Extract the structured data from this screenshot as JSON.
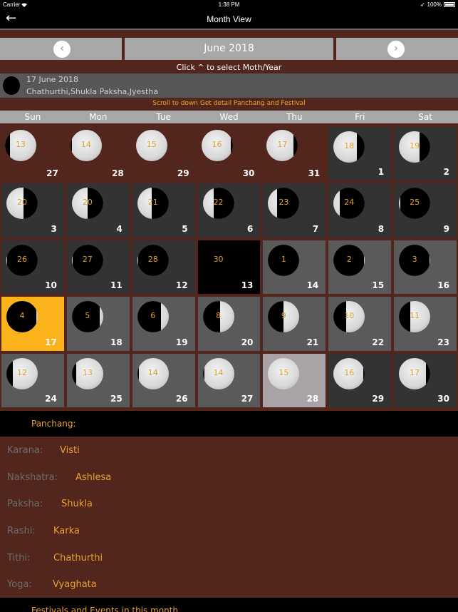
{
  "status_bar": {
    "carrier": "Carrier",
    "time": "1:38 PM",
    "battery": "100%"
  },
  "nav": {
    "title": "Month View",
    "back_icon": "arrow-left-icon"
  },
  "month_selector": {
    "current": "June 2018",
    "prev_icon": "chevron-left-icon",
    "next_icon": "chevron-right-icon",
    "hint": "Click ^ to select Moth/Year"
  },
  "selected_day": {
    "date": "17 June 2018",
    "details": "Chathurthi,Shukla Paksha,Jyestha"
  },
  "scroll_hint": "Scroll to down Get detail Panchang and Festival",
  "weekdays": [
    "Sun",
    "Mon",
    "Tue",
    "Wed",
    "Thu",
    "Fri",
    "Sat"
  ],
  "colors": {
    "background": "#52251d",
    "accent": "#e8a330",
    "selected": "#fbb31b",
    "today": "#a9a2a6"
  },
  "days": [
    {
      "day": "27",
      "tithi": "13",
      "type": "prev",
      "lit": 0.85,
      "shadow": "left"
    },
    {
      "day": "28",
      "tithi": "14",
      "type": "prev",
      "lit": 0.95,
      "shadow": "left"
    },
    {
      "day": "29",
      "tithi": "15",
      "type": "prev",
      "lit": 1.0,
      "shadow": "none"
    },
    {
      "day": "30",
      "tithi": "16",
      "type": "prev",
      "lit": 0.95,
      "shadow": "right"
    },
    {
      "day": "31",
      "tithi": "17",
      "type": "prev",
      "lit": 0.85,
      "shadow": "right"
    },
    {
      "day": "1",
      "tithi": "18",
      "type": "dark",
      "lit": 0.75,
      "shadow": "right"
    },
    {
      "day": "2",
      "tithi": "19",
      "type": "dark",
      "lit": 0.65,
      "shadow": "right"
    },
    {
      "day": "3",
      "tithi": "20",
      "type": "dark",
      "lit": 0.55,
      "shadow": "right"
    },
    {
      "day": "4",
      "tithi": "20",
      "type": "dark",
      "lit": 0.5,
      "shadow": "right"
    },
    {
      "day": "5",
      "tithi": "21",
      "type": "dark",
      "lit": 0.45,
      "shadow": "right"
    },
    {
      "day": "6",
      "tithi": "22",
      "type": "dark",
      "lit": 0.35,
      "shadow": "right"
    },
    {
      "day": "7",
      "tithi": "23",
      "type": "dark",
      "lit": 0.28,
      "shadow": "right"
    },
    {
      "day": "8",
      "tithi": "24",
      "type": "dark",
      "lit": 0.2,
      "shadow": "right"
    },
    {
      "day": "9",
      "tithi": "25",
      "type": "dark",
      "lit": 0.05,
      "shadow": "right"
    },
    {
      "day": "10",
      "tithi": "26",
      "type": "dark",
      "lit": 0.03,
      "shadow": "right"
    },
    {
      "day": "11",
      "tithi": "27",
      "type": "dark",
      "lit": 0.02,
      "shadow": "right"
    },
    {
      "day": "12",
      "tithi": "28",
      "type": "dark",
      "lit": 0.02,
      "shadow": "right"
    },
    {
      "day": "13",
      "tithi": "30",
      "type": "black",
      "lit": 0.0,
      "shadow": "full"
    },
    {
      "day": "14",
      "tithi": "1",
      "type": "gray",
      "lit": 0.0,
      "shadow": "full"
    },
    {
      "day": "15",
      "tithi": "2",
      "type": "gray",
      "lit": 0.02,
      "shadow": "left"
    },
    {
      "day": "16",
      "tithi": "3",
      "type": "gray",
      "lit": 0.03,
      "shadow": "left"
    },
    {
      "day": "17",
      "tithi": "4",
      "type": "sel",
      "lit": 0.05,
      "shadow": "left"
    },
    {
      "day": "18",
      "tithi": "5",
      "type": "gray",
      "lit": 0.12,
      "shadow": "left"
    },
    {
      "day": "19",
      "tithi": "6",
      "type": "gray",
      "lit": 0.25,
      "shadow": "left"
    },
    {
      "day": "20",
      "tithi": "8",
      "type": "gray",
      "lit": 0.45,
      "shadow": "left"
    },
    {
      "day": "21",
      "tithi": "9",
      "type": "gray",
      "lit": 0.5,
      "shadow": "left"
    },
    {
      "day": "22",
      "tithi": "10",
      "type": "gray",
      "lit": 0.6,
      "shadow": "left"
    },
    {
      "day": "23",
      "tithi": "11",
      "type": "gray",
      "lit": 0.65,
      "shadow": "left"
    },
    {
      "day": "24",
      "tithi": "12",
      "type": "gray",
      "lit": 0.8,
      "shadow": "left"
    },
    {
      "day": "25",
      "tithi": "13",
      "type": "gray",
      "lit": 0.85,
      "shadow": "left"
    },
    {
      "day": "26",
      "tithi": "14",
      "type": "gray",
      "lit": 0.95,
      "shadow": "left"
    },
    {
      "day": "27",
      "tithi": "14",
      "type": "gray",
      "lit": 0.95,
      "shadow": "left"
    },
    {
      "day": "28",
      "tithi": "15",
      "type": "today",
      "lit": 1.0,
      "shadow": "none"
    },
    {
      "day": "29",
      "tithi": "16",
      "type": "dark",
      "lit": 0.95,
      "shadow": "right"
    },
    {
      "day": "30",
      "tithi": "17",
      "type": "dark",
      "lit": 0.85,
      "shadow": "right"
    }
  ],
  "panchang": {
    "title": "Panchang:",
    "rows": [
      {
        "key": "Karana:",
        "value": "Visti"
      },
      {
        "key": "Nakshatra:",
        "value": "Ashlesa"
      },
      {
        "key": "Paksha:",
        "value": "Shukla"
      },
      {
        "key": "Rashi:",
        "value": "Karka"
      },
      {
        "key": "Tithi:",
        "value": "Chathurthi"
      },
      {
        "key": "Yoga:",
        "value": "Vyaghata"
      }
    ]
  },
  "festivals": {
    "title": "Festivals and Events in this month"
  }
}
